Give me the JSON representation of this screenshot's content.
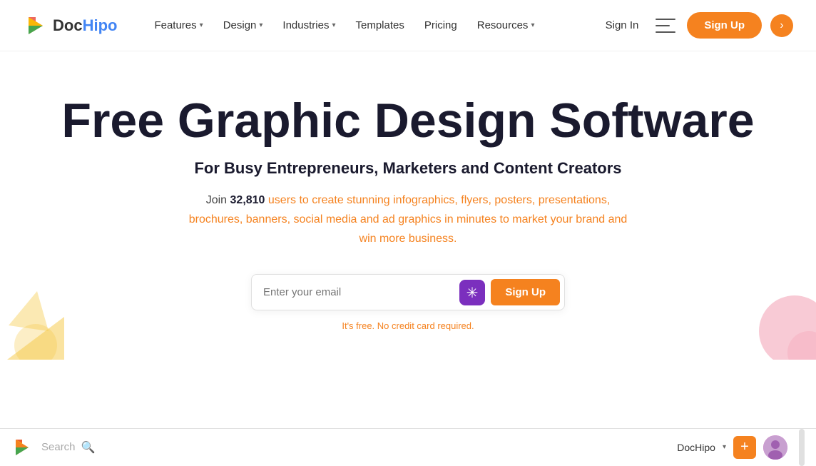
{
  "navbar": {
    "logo_doc": "Doc",
    "logo_hipo": "Hipo",
    "nav_items": [
      {
        "label": "Features",
        "has_dropdown": true
      },
      {
        "label": "Design",
        "has_dropdown": true
      },
      {
        "label": "Industries",
        "has_dropdown": true
      },
      {
        "label": "Templates",
        "has_dropdown": false
      },
      {
        "label": "Pricing",
        "has_dropdown": false
      },
      {
        "label": "Resources",
        "has_dropdown": true
      }
    ],
    "sign_in": "Sign In",
    "sign_up": "Sign Up"
  },
  "hero": {
    "title": "Free Graphic Design Software",
    "subtitle": "For Busy Entrepreneurs, Marketers and Content Creators",
    "desc_prefix": "Join ",
    "desc_count": "32,810",
    "desc_suffix": " users to create stunning infographics, flyers, posters, presentations, brochures, banners, social media and ad graphics in minutes to market your brand and win more business.",
    "email_placeholder": "Enter your email",
    "signup_btn": "Sign Up",
    "free_note": "It's free. No credit card required."
  },
  "bottom_bar": {
    "search_placeholder": "Search",
    "user_name": "DocHipo",
    "plus_label": "+"
  }
}
